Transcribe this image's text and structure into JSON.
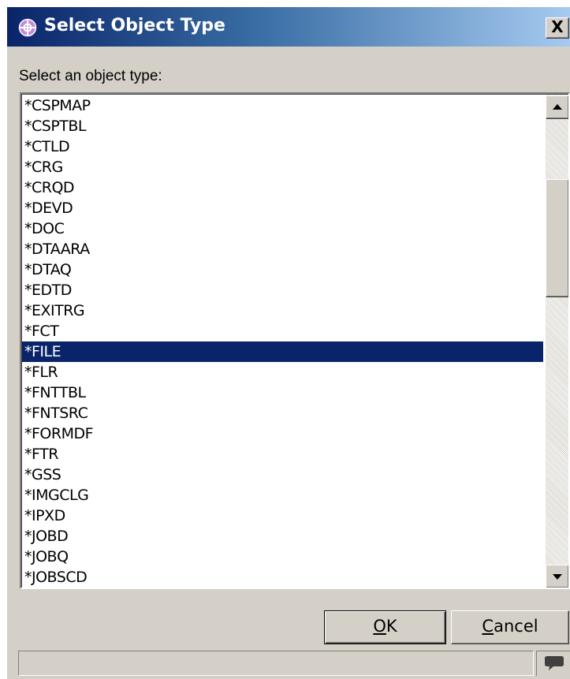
{
  "dialog": {
    "title": "Select Object Type",
    "close_label": "X",
    "title_icon": "perspective-icon",
    "title_gradient": [
      "#0a246a",
      "#a6caf0"
    ]
  },
  "prompt": "Select an object type:",
  "object_types": [
    {
      "label": "*CSPMAP",
      "selected": false
    },
    {
      "label": "*CSPTBL",
      "selected": false
    },
    {
      "label": "*CTLD",
      "selected": false
    },
    {
      "label": "*CRG",
      "selected": false
    },
    {
      "label": "*CRQD",
      "selected": false
    },
    {
      "label": "*DEVD",
      "selected": false
    },
    {
      "label": "*DOC",
      "selected": false
    },
    {
      "label": "*DTAARA",
      "selected": false
    },
    {
      "label": "*DTAQ",
      "selected": false
    },
    {
      "label": "*EDTD",
      "selected": false
    },
    {
      "label": "*EXITRG",
      "selected": false
    },
    {
      "label": "*FCT",
      "selected": false
    },
    {
      "label": "*FILE",
      "selected": true
    },
    {
      "label": "*FLR",
      "selected": false
    },
    {
      "label": "*FNTTBL",
      "selected": false
    },
    {
      "label": "*FNTSRC",
      "selected": false
    },
    {
      "label": "*FORMDF",
      "selected": false
    },
    {
      "label": "*FTR",
      "selected": false
    },
    {
      "label": "*GSS",
      "selected": false
    },
    {
      "label": "*IMGCLG",
      "selected": false
    },
    {
      "label": "*IPXD",
      "selected": false
    },
    {
      "label": "*JOBD",
      "selected": false
    },
    {
      "label": "*JOBQ",
      "selected": false
    },
    {
      "label": "*JOBSCD",
      "selected": false
    }
  ],
  "selection_color": "#0a246a",
  "buttons": {
    "ok": {
      "accel": "O",
      "rest": "K"
    },
    "cancel": {
      "accel": "C",
      "rest": "ancel"
    }
  },
  "statusbar": {
    "text": "",
    "icon": "speech-bubble-icon"
  }
}
